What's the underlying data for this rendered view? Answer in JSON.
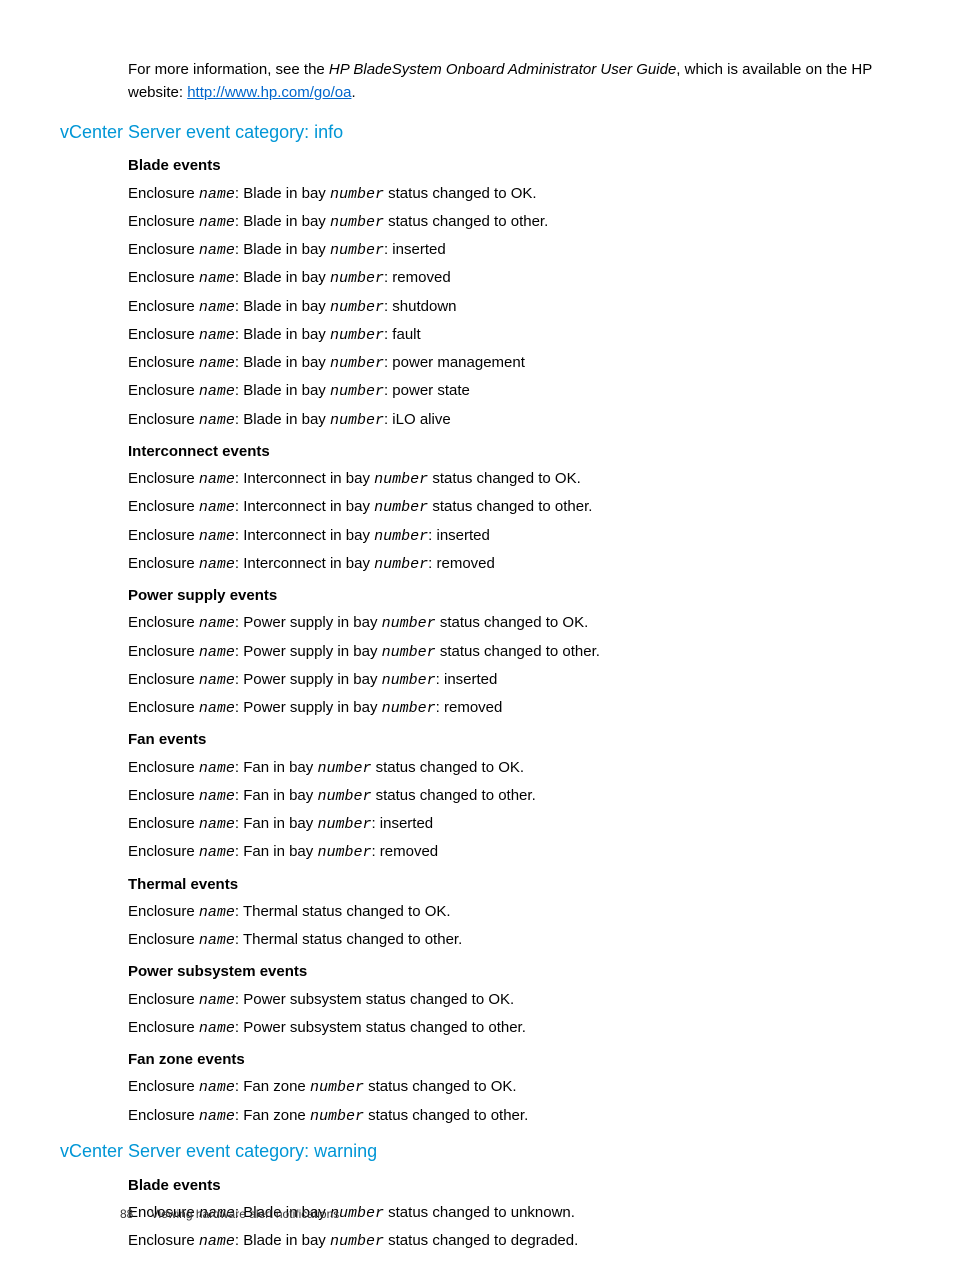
{
  "intro": {
    "prefix": "For more information, see the ",
    "italic": "HP BladeSystem Onboard Administrator User Guide",
    "mid": ", which is available on the HP website: ",
    "link_text": "http://www.hp.com/go/oa",
    "suffix": "."
  },
  "sections": [
    {
      "heading": "vCenter Server event category: info",
      "groups": [
        {
          "title": "Blade events",
          "events": [
            {
              "p": "Enclosure ",
              "v1": "name",
              "m": ": Blade in bay ",
              "v2": "number",
              "s": " status changed to OK."
            },
            {
              "p": "Enclosure ",
              "v1": "name",
              "m": ": Blade in bay ",
              "v2": "number",
              "s": " status changed to other."
            },
            {
              "p": "Enclosure ",
              "v1": "name",
              "m": ": Blade in bay ",
              "v2": "number",
              "s": ": inserted"
            },
            {
              "p": "Enclosure ",
              "v1": "name",
              "m": ": Blade in bay ",
              "v2": "number",
              "s": ": removed"
            },
            {
              "p": "Enclosure ",
              "v1": "name",
              "m": ": Blade in bay ",
              "v2": "number",
              "s": ": shutdown"
            },
            {
              "p": "Enclosure ",
              "v1": "name",
              "m": ": Blade in bay ",
              "v2": "number",
              "s": ": fault"
            },
            {
              "p": "Enclosure ",
              "v1": "name",
              "m": ": Blade in bay ",
              "v2": "number",
              "s": ": power management"
            },
            {
              "p": "Enclosure ",
              "v1": "name",
              "m": ": Blade in bay ",
              "v2": "number",
              "s": ": power state"
            },
            {
              "p": "Enclosure ",
              "v1": "name",
              "m": ": Blade in bay ",
              "v2": "number",
              "s": ": iLO alive"
            }
          ]
        },
        {
          "title": "Interconnect events",
          "events": [
            {
              "p": "Enclosure ",
              "v1": "name",
              "m": ": Interconnect in bay ",
              "v2": "number",
              "s": " status changed to OK."
            },
            {
              "p": "Enclosure ",
              "v1": "name",
              "m": ": Interconnect in bay ",
              "v2": "number",
              "s": " status changed to other."
            },
            {
              "p": "Enclosure ",
              "v1": "name",
              "m": ": Interconnect in bay ",
              "v2": "number",
              "s": ": inserted"
            },
            {
              "p": "Enclosure ",
              "v1": "name",
              "m": ": Interconnect in bay ",
              "v2": "number",
              "s": ": removed"
            }
          ]
        },
        {
          "title": "Power supply events",
          "events": [
            {
              "p": "Enclosure ",
              "v1": "name",
              "m": ": Power supply in bay ",
              "v2": "number",
              "s": " status changed to OK."
            },
            {
              "p": "Enclosure ",
              "v1": "name",
              "m": ": Power supply in bay ",
              "v2": "number",
              "s": " status changed to other."
            },
            {
              "p": "Enclosure ",
              "v1": "name",
              "m": ": Power supply in bay ",
              "v2": "number",
              "s": ": inserted"
            },
            {
              "p": "Enclosure ",
              "v1": "name",
              "m": ": Power supply in bay ",
              "v2": "number",
              "s": ": removed"
            }
          ]
        },
        {
          "title": "Fan events",
          "events": [
            {
              "p": "Enclosure ",
              "v1": "name",
              "m": ": Fan in bay ",
              "v2": "number",
              "s": " status changed to OK."
            },
            {
              "p": "Enclosure ",
              "v1": "name",
              "m": ": Fan in bay ",
              "v2": "number",
              "s": " status changed to other."
            },
            {
              "p": "Enclosure ",
              "v1": "name",
              "m": ": Fan in bay ",
              "v2": "number",
              "s": ": inserted"
            },
            {
              "p": "Enclosure ",
              "v1": "name",
              "m": ": Fan in bay ",
              "v2": "number",
              "s": ": removed"
            }
          ]
        },
        {
          "title": "Thermal events",
          "events": [
            {
              "p": "Enclosure ",
              "v1": "name",
              "m": ": Thermal status changed to OK.",
              "v2": "",
              "s": ""
            },
            {
              "p": "Enclosure ",
              "v1": "name",
              "m": ": Thermal status changed to other.",
              "v2": "",
              "s": ""
            }
          ]
        },
        {
          "title": "Power subsystem events",
          "events": [
            {
              "p": "Enclosure ",
              "v1": "name",
              "m": ": Power subsystem status changed to OK.",
              "v2": "",
              "s": ""
            },
            {
              "p": "Enclosure ",
              "v1": "name",
              "m": ": Power subsystem status changed to other.",
              "v2": "",
              "s": ""
            }
          ]
        },
        {
          "title": "Fan zone events",
          "events": [
            {
              "p": "Enclosure ",
              "v1": "name",
              "m": ": Fan zone ",
              "v2": "number",
              "s": " status changed to OK."
            },
            {
              "p": "Enclosure ",
              "v1": "name",
              "m": ": Fan zone ",
              "v2": "number",
              "s": " status changed to other."
            }
          ]
        }
      ]
    },
    {
      "heading": "vCenter Server event category: warning",
      "groups": [
        {
          "title": "Blade events",
          "events": [
            {
              "p": "Enclosure ",
              "v1": "name",
              "m": ": Blade in bay ",
              "v2": "number",
              "s": " status changed to unknown."
            },
            {
              "p": "Enclosure ",
              "v1": "name",
              "m": ": Blade in bay ",
              "v2": "number",
              "s": " status changed to degraded."
            }
          ]
        }
      ]
    }
  ],
  "footer": {
    "page": "88",
    "title": "Viewing hardware alert notifications"
  }
}
